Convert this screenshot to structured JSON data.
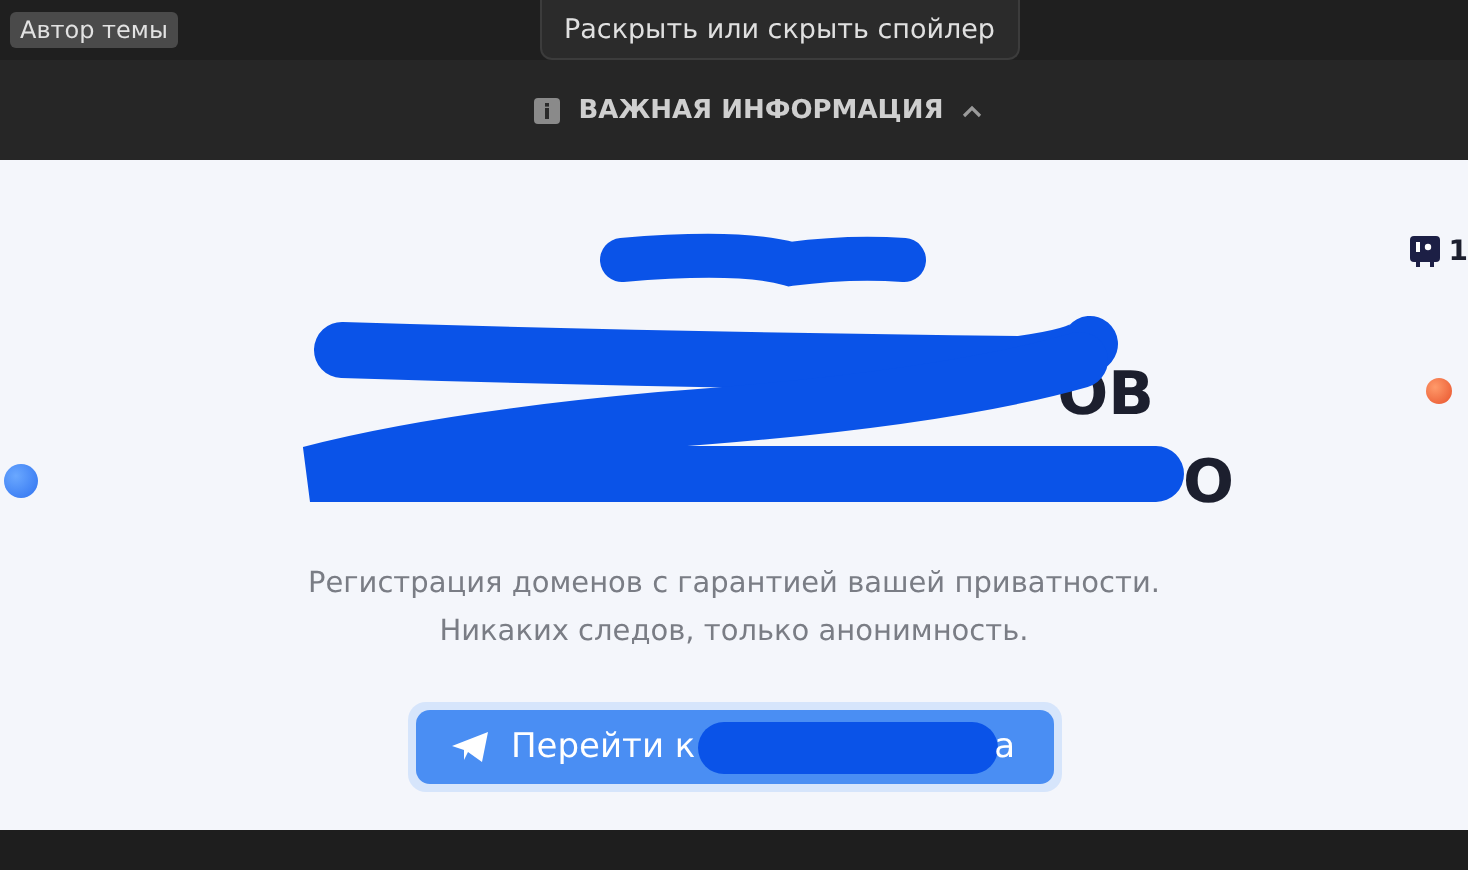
{
  "author_badge": "Автор темы",
  "tooltip": "Раскрыть или скрыть спойлер",
  "spoiler": {
    "title": "ВАЖНАЯ ИНФОРМАЦИЯ",
    "expanded": true,
    "content": {
      "counter": "1",
      "heading_lines": [
        "ОВ",
        "О"
      ],
      "subtitle_lines": [
        "Регистрация доменов с гарантией вашей приватности.",
        "Никаких следов, только анонимность."
      ],
      "button": {
        "text_start": "Перейти к",
        "text_end": "а"
      }
    }
  }
}
